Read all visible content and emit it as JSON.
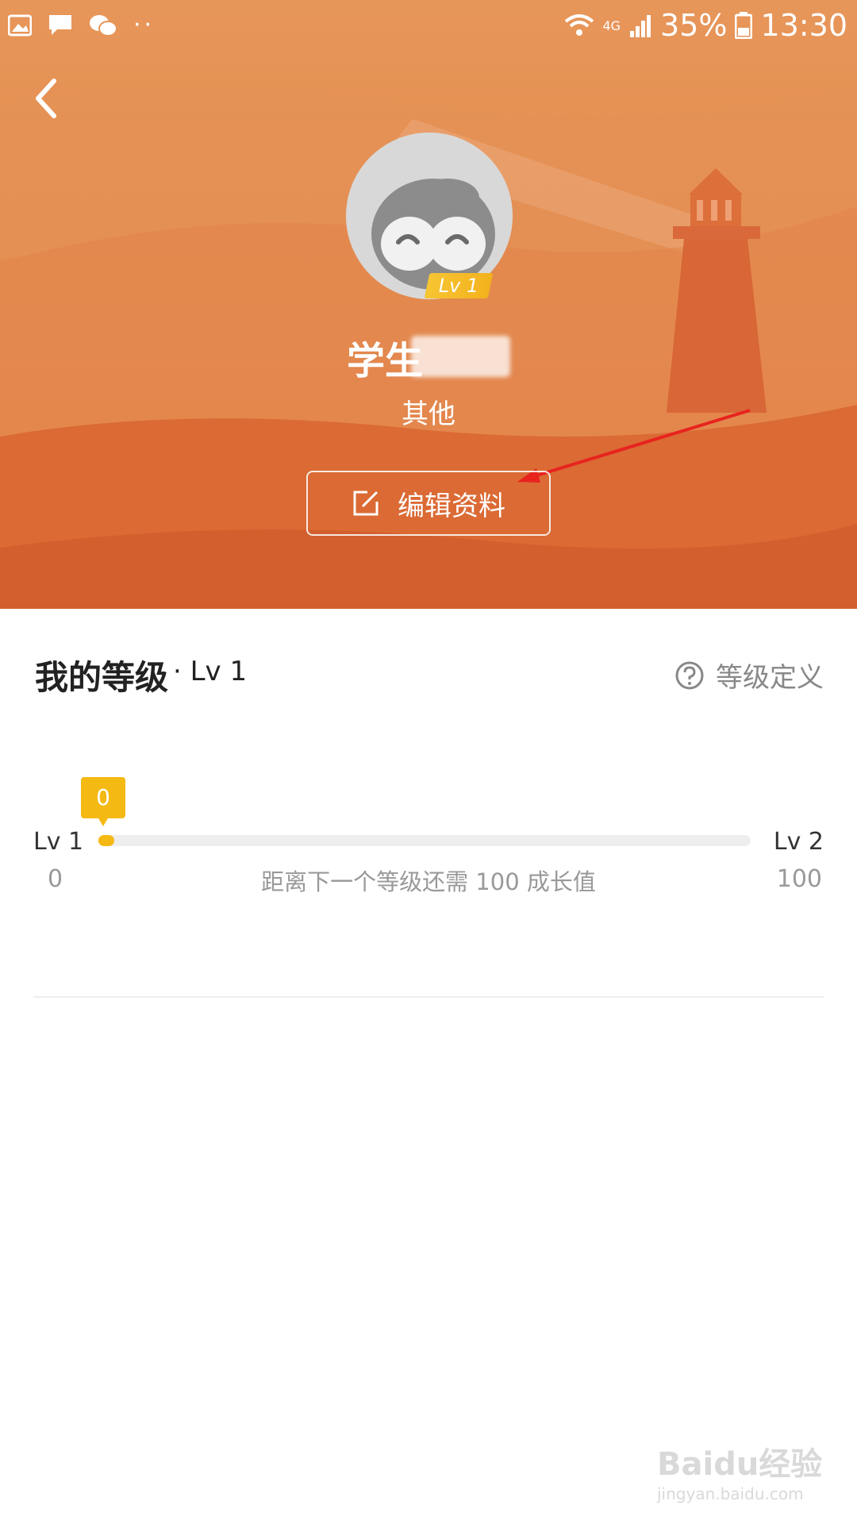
{
  "status_bar": {
    "battery": "35%",
    "time": "13:30",
    "network": "4G",
    "icons": [
      "gallery-icon",
      "message-icon",
      "wechat-icon",
      "more-dots-icon",
      "wifi-icon",
      "signal-icon",
      "battery-icon"
    ]
  },
  "header": {
    "level_badge": "Lv 1",
    "username": "学生",
    "role": "其他",
    "edit_button": "编辑资料"
  },
  "level": {
    "title": "我的等级",
    "current_level": "· Lv 1",
    "definition_link": "等级定义",
    "current_points": "0",
    "progress_fraction": 0.0,
    "start_level": "Lv 1",
    "end_level": "Lv 2",
    "min": "0",
    "max": "100",
    "hint": "距离下一个等级还需 100 成长值"
  },
  "watermark": {
    "brand": "Baidu经验",
    "url": "jingyan.baidu.com"
  },
  "colors": {
    "accent": "#f5b914",
    "hero_top": "#e7965a",
    "hero_bottom": "#df733b",
    "arrow": "#e8231e"
  }
}
